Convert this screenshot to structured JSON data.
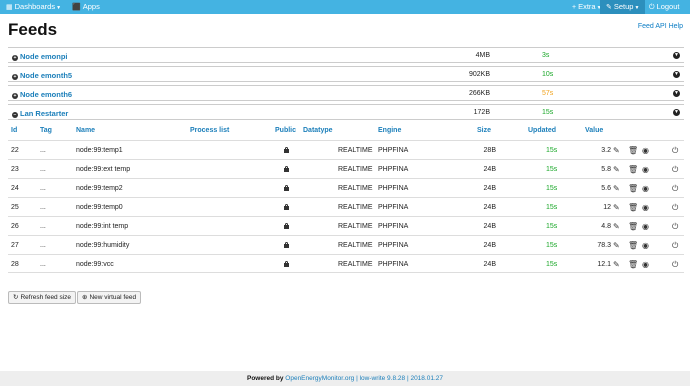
{
  "navbar": {
    "dashboards": "Dashboards",
    "apps": "Apps",
    "extra": "Extra",
    "setup": "Setup",
    "logout": "Logout"
  },
  "header": {
    "title": "Feeds",
    "help": "Feed API Help"
  },
  "nodes": [
    {
      "name": "Node emonpi",
      "size": "4MB",
      "time": "3s",
      "time_color": "green",
      "toggle": "+"
    },
    {
      "name": "Node emonth5",
      "size": "902KB",
      "time": "10s",
      "time_color": "green",
      "toggle": "+"
    },
    {
      "name": "Node emonth6",
      "size": "266KB",
      "time": "57s",
      "time_color": "orange",
      "toggle": "+"
    },
    {
      "name": "Lan Restarter",
      "size": "172B",
      "time": "15s",
      "time_color": "green",
      "toggle": "−"
    }
  ],
  "table": {
    "headers": {
      "id": "Id",
      "tag": "Tag",
      "name": "Name",
      "process": "Process list",
      "public": "Public",
      "datatype": "Datatype",
      "engine": "Engine",
      "size": "Size",
      "updated": "Updated",
      "value": "Value"
    },
    "rows": [
      {
        "id": "22",
        "tag": "...",
        "name": "node:99:temp1",
        "datatype": "REALTIME",
        "engine": "PHPFINA",
        "size": "28B",
        "updated": "15s",
        "value": "3.2"
      },
      {
        "id": "23",
        "tag": "...",
        "name": "node:99:ext temp",
        "datatype": "REALTIME",
        "engine": "PHPFINA",
        "size": "24B",
        "updated": "15s",
        "value": "5.8"
      },
      {
        "id": "24",
        "tag": "...",
        "name": "node:99:temp2",
        "datatype": "REALTIME",
        "engine": "PHPFINA",
        "size": "24B",
        "updated": "15s",
        "value": "5.6"
      },
      {
        "id": "25",
        "tag": "...",
        "name": "node:99:temp0",
        "datatype": "REALTIME",
        "engine": "PHPFINA",
        "size": "24B",
        "updated": "15s",
        "value": "12"
      },
      {
        "id": "26",
        "tag": "...",
        "name": "node:99:int temp",
        "datatype": "REALTIME",
        "engine": "PHPFINA",
        "size": "24B",
        "updated": "15s",
        "value": "4.8"
      },
      {
        "id": "27",
        "tag": "...",
        "name": "node:99:humidity",
        "datatype": "REALTIME",
        "engine": "PHPFINA",
        "size": "24B",
        "updated": "15s",
        "value": "78.3"
      },
      {
        "id": "28",
        "tag": "...",
        "name": "node:99:vcc",
        "datatype": "REALTIME",
        "engine": "PHPFINA",
        "size": "24B",
        "updated": "15s",
        "value": "12.1"
      }
    ]
  },
  "buttons": {
    "refresh": "Refresh feed size",
    "new_virtual": "New virtual feed"
  },
  "footer": {
    "powered": "Powered by",
    "site": "OpenEnergyMonitor.org",
    "sep1": " | ",
    "version": "low-write 9.8.28",
    "sep2": " | ",
    "date": "2018.01.27"
  },
  "colors": {
    "navbar": "#44b3e2",
    "link": "#1c7fba",
    "updated_green": "#1aa829",
    "updated_orange": "#f0a21c"
  }
}
